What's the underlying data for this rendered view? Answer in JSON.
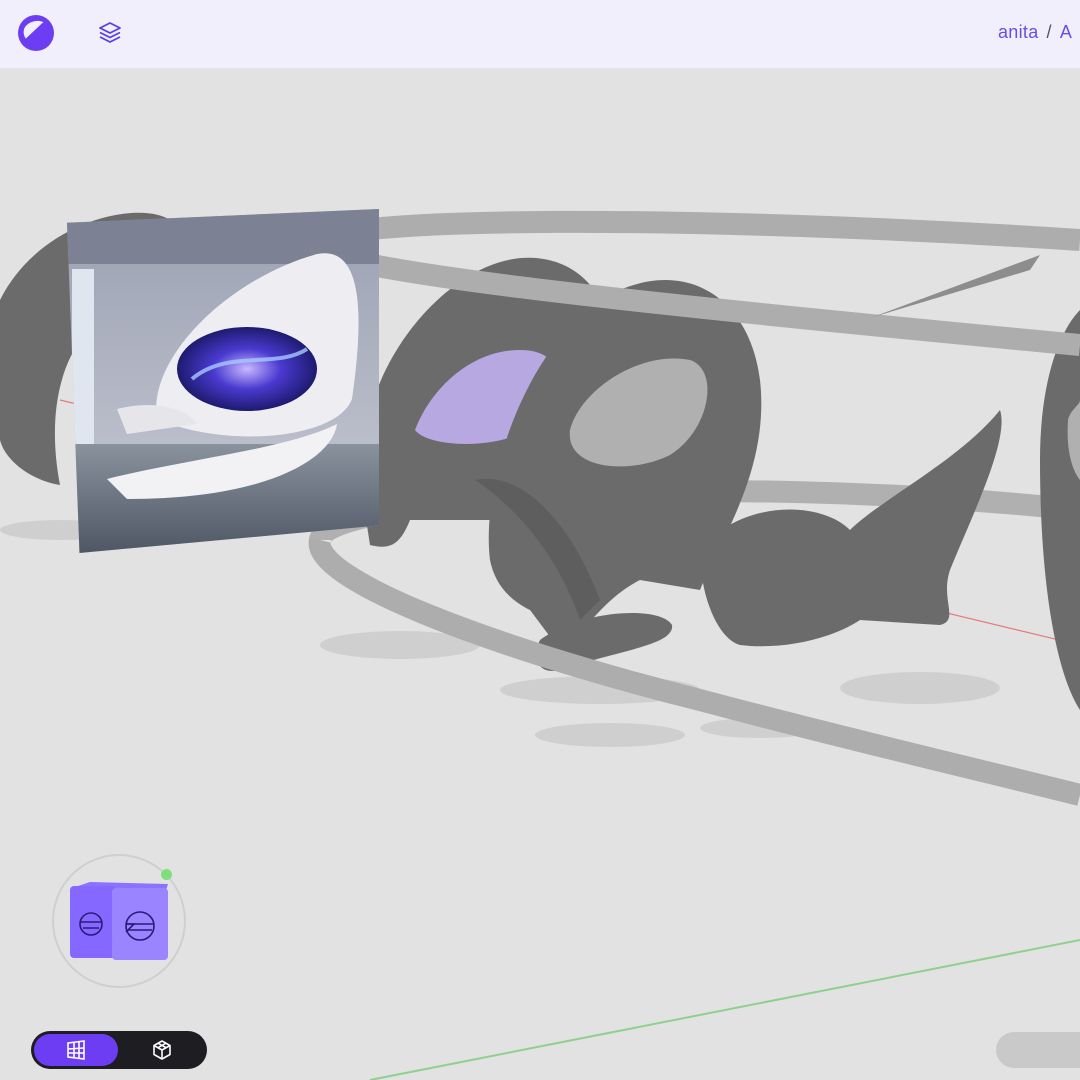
{
  "header": {
    "logo_icon": "spoolr-logo-icon",
    "layers_icon": "layers-icon",
    "breadcrumb": {
      "user": "anita",
      "separator": "/",
      "project_initial": "A"
    }
  },
  "viewport": {
    "reference_image": "futuristic-interior-reference",
    "navigation_cube": "view-navigation-cube",
    "status_dot_color": "#7de07a"
  },
  "view_toggle": {
    "options": [
      {
        "icon": "floorplan-grid-icon",
        "active": true
      },
      {
        "icon": "3d-cube-icon",
        "active": false
      }
    ]
  },
  "colors": {
    "accent": "#6c3df3",
    "breadcrumb": "#6a4de6",
    "topbar_bg": "#f1effc",
    "canvas_bg": "#e2e2e2"
  }
}
